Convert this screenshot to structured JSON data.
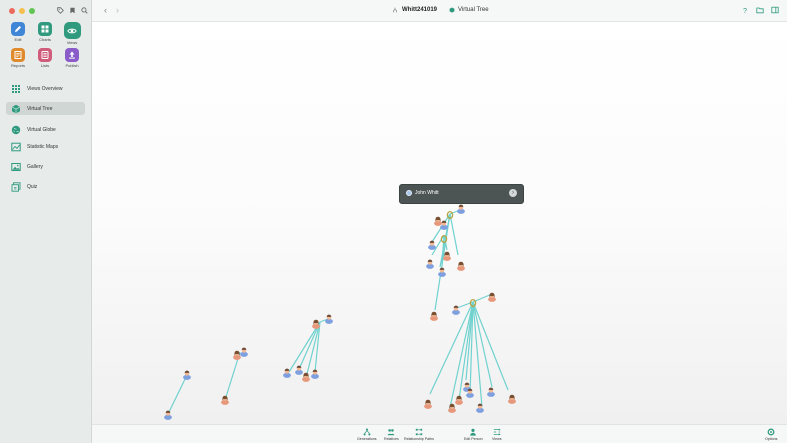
{
  "colors": {
    "accent": "#2f9a7e",
    "line": "#6fd2cf",
    "male": "#7e9fe0",
    "female": "#e7977a"
  },
  "sidebar": {
    "modules": [
      {
        "label": "Edit",
        "icon": "pencil-icon",
        "color": "#3f86d6"
      },
      {
        "label": "Charts",
        "icon": "charts-icon",
        "color": "#2f9a7e"
      },
      {
        "label": "Views",
        "icon": "eye-icon",
        "color": "#2f9a7e",
        "active": true
      },
      {
        "label": "Reports",
        "icon": "reports-icon",
        "color": "#e08a2e"
      },
      {
        "label": "Lists",
        "icon": "lists-icon",
        "color": "#d05c7b"
      },
      {
        "label": "Publish",
        "icon": "publish-icon",
        "color": "#8a5cc9"
      }
    ],
    "nav": [
      {
        "label": "Views Overview",
        "icon": "grid-icon"
      },
      {
        "label": "Virtual Tree",
        "icon": "cube-icon",
        "selected": true
      },
      {
        "label": "Virtual Globe",
        "icon": "globe-icon"
      },
      {
        "label": "Statistic Maps",
        "icon": "map-icon"
      },
      {
        "label": "Gallery",
        "icon": "gallery-icon"
      },
      {
        "label": "Quiz",
        "icon": "quiz-icon"
      }
    ]
  },
  "toolbar": {
    "family_name": "Whitt241019",
    "view_name": "Virtual Tree"
  },
  "popup": {
    "person_name": "John Whitt"
  },
  "bottombar": {
    "items": [
      {
        "label": "Generations",
        "icon": "generations-icon"
      },
      {
        "label": "Relatives",
        "icon": "relatives-icon"
      },
      {
        "label": "Relationship Paths",
        "icon": "relationship-paths-icon"
      },
      {
        "label": "Edit Person",
        "icon": "edit-person-icon"
      },
      {
        "label": "Views",
        "icon": "views-icon"
      },
      {
        "label": "Options",
        "icon": "options-icon"
      }
    ]
  }
}
